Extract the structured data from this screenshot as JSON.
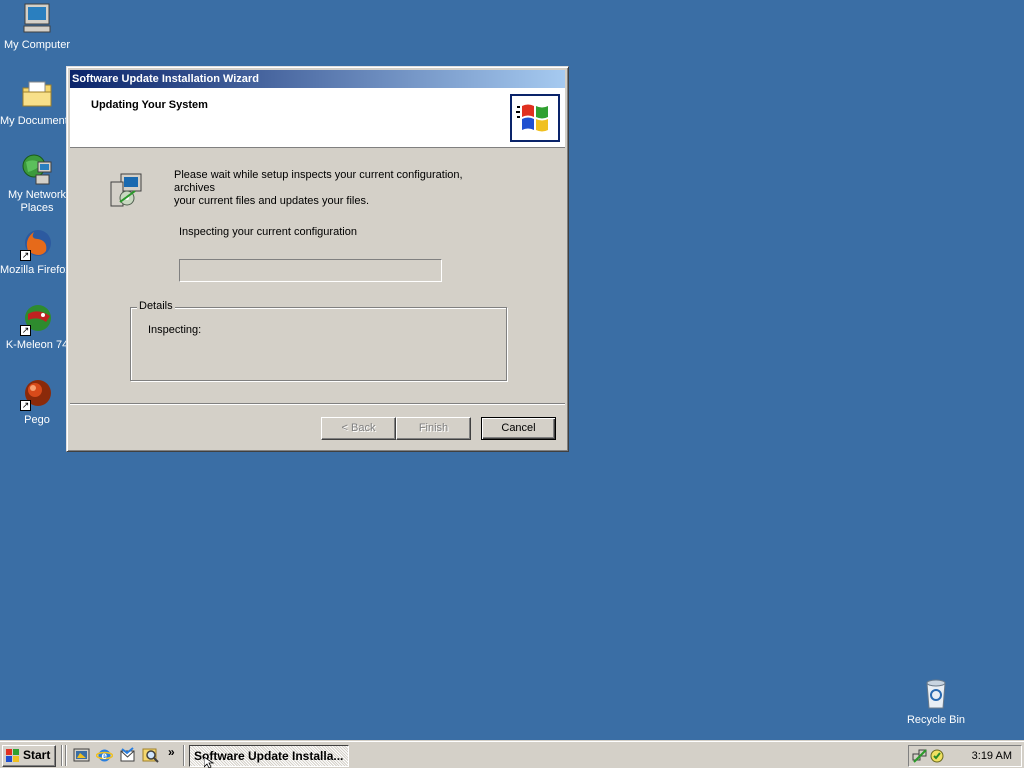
{
  "desktop": {
    "icons": [
      {
        "label": "My Computer",
        "icon": "computer-icon"
      },
      {
        "label": "My Documents",
        "icon": "folder-icon"
      },
      {
        "label": "My Network Places",
        "icon": "network-icon"
      },
      {
        "label": "Mozilla Firefox",
        "icon": "firefox-icon"
      },
      {
        "label": "K-Meleon 74",
        "icon": "kmeleon-icon"
      },
      {
        "label": "Pego",
        "icon": "pego-icon"
      },
      {
        "label": "Recycle Bin",
        "icon": "recycle-bin-icon"
      }
    ]
  },
  "wizard": {
    "title": "Software Update Installation Wizard",
    "header_title": "Updating Your System",
    "intro_line1": "Please wait while setup inspects your current configuration, archives",
    "intro_line2": "your current files and updates your files.",
    "status": "Inspecting your current configuration",
    "progress": 0,
    "details_legend": "Details",
    "details_text": "Inspecting:",
    "buttons": {
      "back": "< Back",
      "finish": "Finish",
      "cancel": "Cancel"
    }
  },
  "taskbar": {
    "start_label": "Start",
    "quick_launch": [
      "show-desktop-icon",
      "internet-explorer-icon",
      "outlook-express-icon",
      "search-icon"
    ],
    "more": "»",
    "task_label": "Software Update Installa...",
    "clock": "3:19 AM",
    "tray": [
      "network-tray-icon",
      "update-tray-icon"
    ]
  },
  "colors": {
    "desktop": "#3a6ea5",
    "titlebar_start": "#0a246a",
    "titlebar_end": "#a6caf0",
    "face": "#d4d0c8"
  }
}
